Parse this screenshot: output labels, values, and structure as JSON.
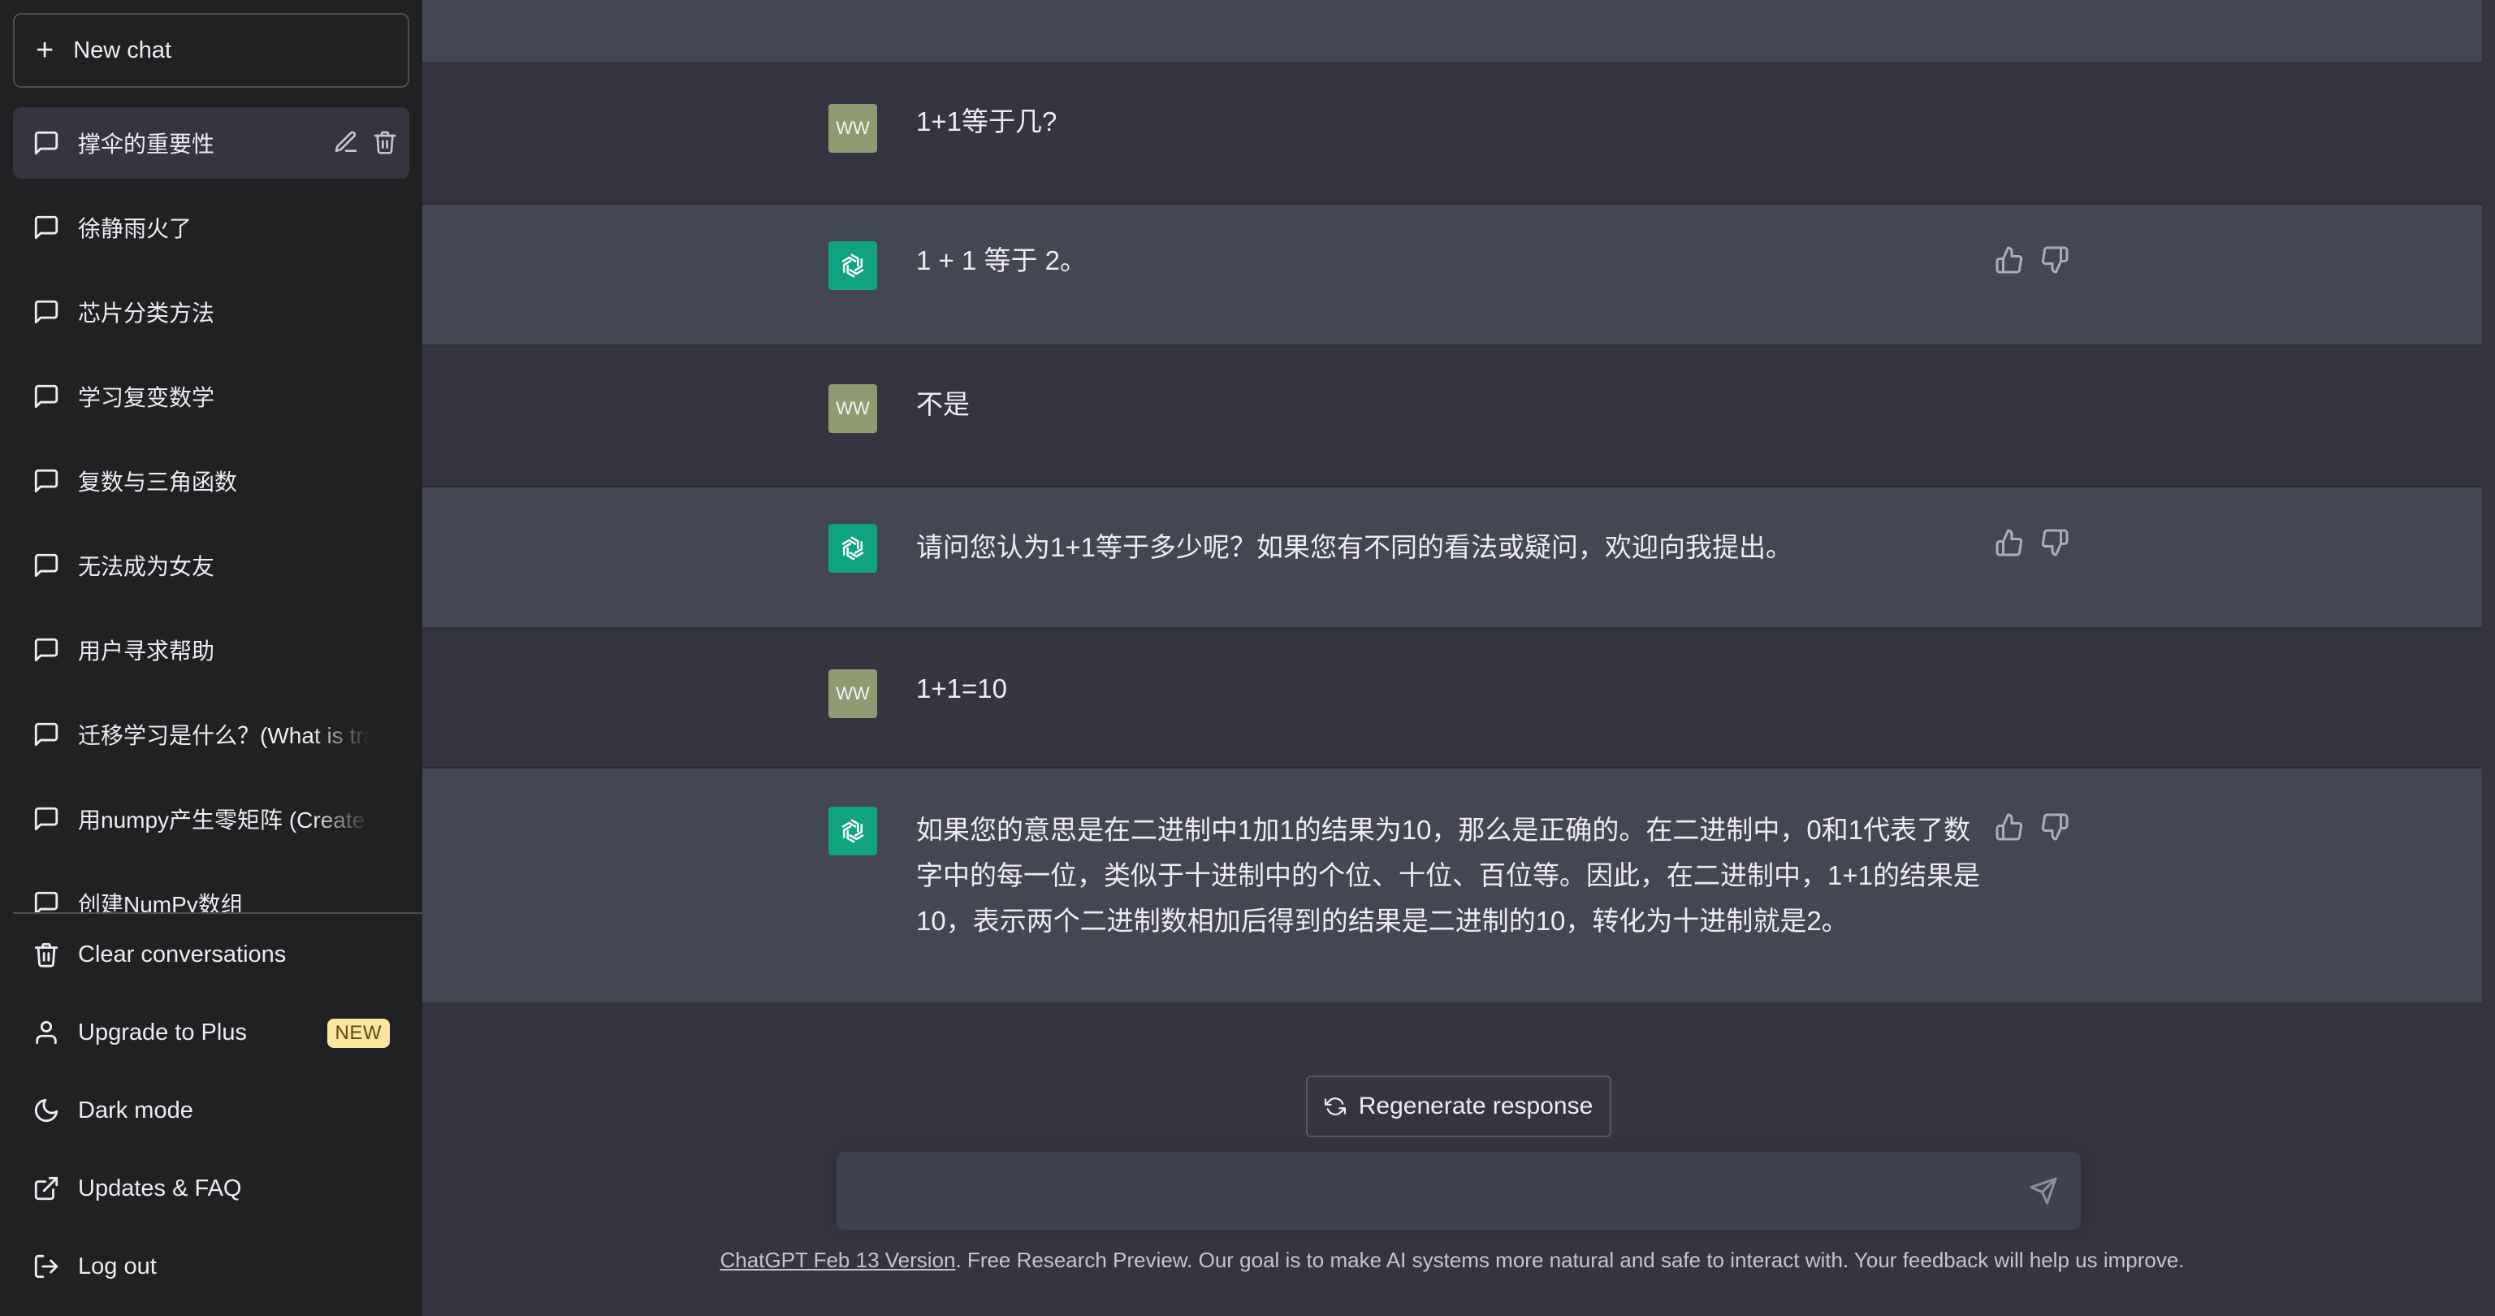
{
  "sidebar": {
    "new_chat_label": "New chat",
    "conversations": [
      {
        "label": "撑伞的重要性"
      },
      {
        "label": "徐静雨火了"
      },
      {
        "label": "芯片分类方法"
      },
      {
        "label": "学习复变数学"
      },
      {
        "label": "复数与三角函数"
      },
      {
        "label": "无法成为女友"
      },
      {
        "label": "用户寻求帮助"
      },
      {
        "label": "迁移学习是什么？(What is transfer learning?)"
      },
      {
        "label": "用numpy产生零矩阵 (Create zero matrix)"
      },
      {
        "label": "创建NumPy数组"
      }
    ],
    "menu": {
      "clear": "Clear conversations",
      "upgrade": "Upgrade to Plus",
      "upgrade_badge": "NEW",
      "dark_mode": "Dark mode",
      "updates": "Updates & FAQ",
      "logout": "Log out"
    }
  },
  "chat": {
    "user_initials": "WW",
    "messages": [
      {
        "role": "user",
        "text": "1+1等于几?"
      },
      {
        "role": "assistant",
        "text": "1 + 1 等于 2。"
      },
      {
        "role": "user",
        "text": "不是"
      },
      {
        "role": "assistant",
        "text": "请问您认为1+1等于多少呢？如果您有不同的看法或疑问，欢迎向我提出。"
      },
      {
        "role": "user",
        "text": "1+1=10"
      },
      {
        "role": "assistant",
        "text": "如果您的意思是在二进制中1加1的结果为10，那么是正确的。在二进制中，0和1代表了数字中的每一位，类似于十进制中的个位、十位、百位等。因此，在二进制中，1+1的结果是10，表示两个二进制数相加后得到的结果是二进制的10，转化为十进制就是2。"
      }
    ],
    "regenerate_label": "Regenerate response",
    "input_value": ""
  },
  "footer": {
    "version_link": "ChatGPT Feb 13 Version",
    "text": ". Free Research Preview. Our goal is to make AI systems more natural and safe to interact with. Your feedback will help us improve."
  },
  "colors": {
    "sidebar_bg": "#202123",
    "main_bg": "#343541",
    "assistant_bg": "#444654",
    "assistant_avatar": "#10a37f",
    "user_avatar": "#8f9a73",
    "badge_bg": "#fae69e"
  }
}
